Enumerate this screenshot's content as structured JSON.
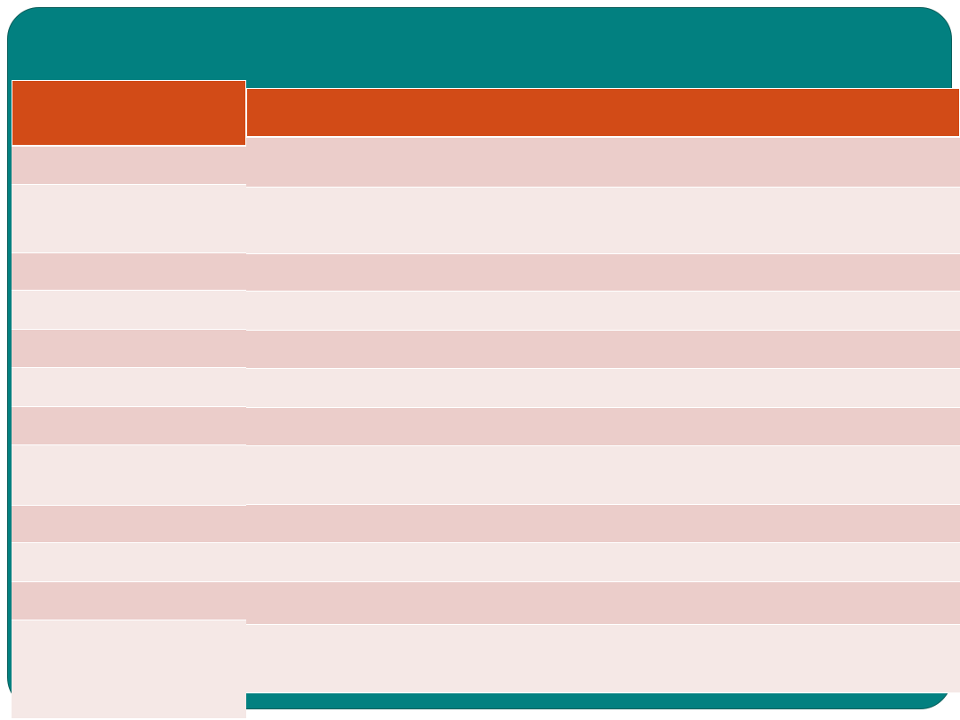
{
  "colors": {
    "banner": "#028080",
    "header": "#d24b17",
    "row_dark": "#ebcdca",
    "row_light": "#f5e8e6",
    "background": "#ffffff"
  },
  "table_left": {
    "header": "",
    "rows": [
      {
        "text": "",
        "shade": "dark"
      },
      {
        "text": "",
        "shade": "light"
      },
      {
        "text": "",
        "shade": "dark"
      },
      {
        "text": "",
        "shade": "light"
      },
      {
        "text": "",
        "shade": "dark"
      },
      {
        "text": "",
        "shade": "light"
      },
      {
        "text": "",
        "shade": "dark"
      },
      {
        "text": "",
        "shade": "light"
      },
      {
        "text": "",
        "shade": "dark"
      },
      {
        "text": "",
        "shade": "light"
      },
      {
        "text": "",
        "shade": "dark"
      },
      {
        "text": "",
        "shade": "light"
      }
    ]
  },
  "table_right": {
    "header": "",
    "rows": [
      {
        "text": "",
        "shade": "dark"
      },
      {
        "text": "",
        "shade": "light"
      },
      {
        "text": "",
        "shade": "dark"
      },
      {
        "text": "",
        "shade": "light"
      },
      {
        "text": "",
        "shade": "dark"
      },
      {
        "text": "",
        "shade": "light"
      },
      {
        "text": "",
        "shade": "dark"
      },
      {
        "text": "",
        "shade": "light"
      },
      {
        "text": "",
        "shade": "dark"
      },
      {
        "text": "",
        "shade": "light"
      },
      {
        "text": "",
        "shade": "dark"
      },
      {
        "text": "",
        "shade": "light"
      }
    ]
  }
}
